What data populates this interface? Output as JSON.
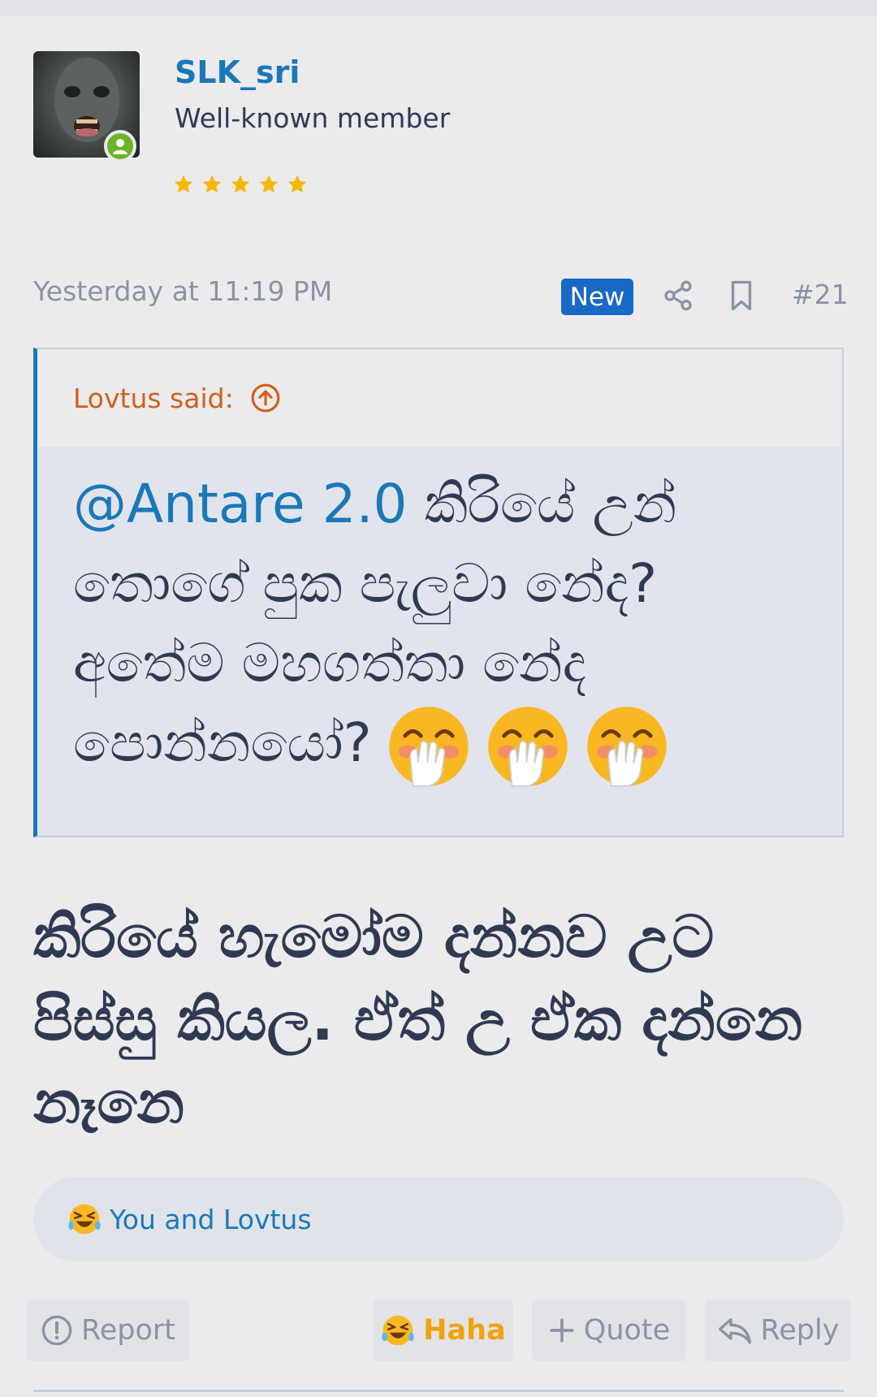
{
  "user": {
    "name": "SLK_sri",
    "title": "Well-known member",
    "stars": 5
  },
  "post": {
    "date": "Yesterday at 11:19 PM",
    "badge": "New",
    "number": "#21"
  },
  "quote": {
    "author_label": "Lovtus said:",
    "mention": "@Antare 2.0",
    "text": " කිරියේ උන් තොගේ පුක පැලුවා නේද? අතේම මහගත්තා නේද පොන්නයෝ?"
  },
  "body_text": "කිරියේ හැමෝම දන්නව උට පිස්සු කියල. ඒත් උ ඒක දන්නෙ නෑනෙ",
  "reactions": {
    "summary": "You and Lovtus"
  },
  "actions": {
    "report": "Report",
    "haha": "Haha",
    "quote": "Quote",
    "reply": "Reply"
  },
  "colors": {
    "link_blue": "#1b78b8",
    "badge_blue": "#1769c4",
    "quote_orange": "#d0601c",
    "haha_gold": "#f2a20a",
    "online_green": "#6fb326"
  }
}
